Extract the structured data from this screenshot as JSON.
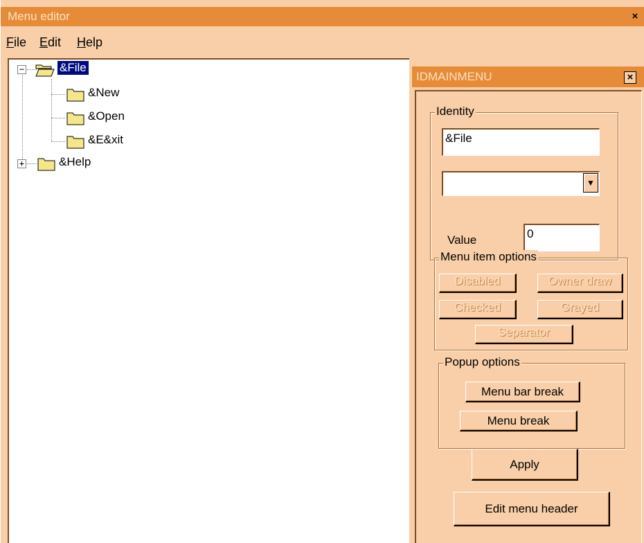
{
  "window": {
    "title": "Menu editor",
    "close_glyph": "×"
  },
  "menubar": {
    "items": [
      {
        "accel": "F",
        "rest": "ile"
      },
      {
        "accel": "E",
        "rest": "dit"
      },
      {
        "accel": "H",
        "rest": "elp"
      }
    ]
  },
  "tree": {
    "root": {
      "label": "&File",
      "expander": "−",
      "selected": true
    },
    "children": [
      {
        "label": "&New"
      },
      {
        "label": "&Open"
      },
      {
        "label": "&E&xit"
      }
    ],
    "sibling": {
      "label": "&Help",
      "expander": "+"
    }
  },
  "props": {
    "title": "IDMAINMENU",
    "close_glyph": "×",
    "identity": {
      "label": "Identity",
      "name_value": "&File",
      "combo_value": "",
      "combo_arrow": "▼",
      "value_label": "Value",
      "value_value": "0"
    },
    "item_options": {
      "label": "Menu item options",
      "disabled": "Disabled",
      "owner_draw": "Owner draw",
      "checked": "Checked",
      "grayed": "Grayed",
      "separator": "Separator"
    },
    "popup_options": {
      "label": "Popup options",
      "menu_bar_break": "Menu bar break",
      "menu_break": "Menu break"
    },
    "apply": "Apply",
    "edit_header": "Edit menu header"
  },
  "colors": {
    "titlebar": "#e68c38",
    "face": "#f8cfa8",
    "selection": "#000a7f",
    "folder": "#f5e68a"
  }
}
